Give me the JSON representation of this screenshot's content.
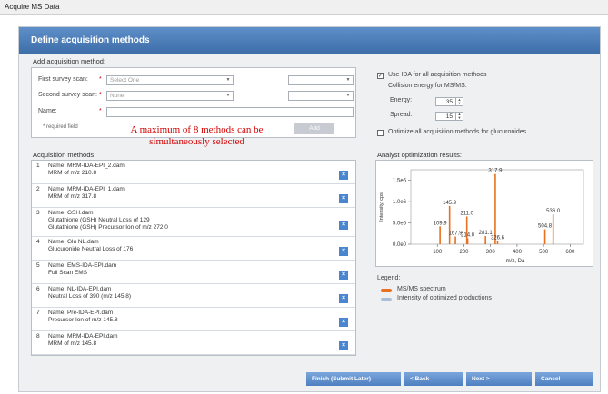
{
  "window": {
    "title": "Acquire MS Data"
  },
  "header": {
    "title": "Define acquisition methods"
  },
  "add_section": {
    "title": "Add acquisition method:",
    "first_survey_label": "First survey scan:",
    "first_survey_value": "Select One",
    "second_survey_label": "Second survey scan:",
    "second_survey_value": "None",
    "name_label": "Name:",
    "required_marker": "*",
    "required_note": "* required field",
    "add_button": "Add"
  },
  "note": "A maximum of 8 methods can be simultaneously selected",
  "methods_section": {
    "title": "Acquisition methods",
    "delete_glyph": "×",
    "items": [
      {
        "num": "1",
        "lines": [
          "Name: MRM-IDA-EPI_2.dam",
          "MRM of m/z 210.8"
        ]
      },
      {
        "num": "2",
        "lines": [
          "Name: MRM-IDA-EPI_1.dam",
          "MRM of m/z 317.8"
        ]
      },
      {
        "num": "3",
        "lines": [
          "Name: GSH.dam",
          "Glutathione (GSH) Neutral Loss of 129",
          "Glutathione (GSH) Precursor Ion of m/z 272.0"
        ]
      },
      {
        "num": "4",
        "lines": [
          "Name: Glu NL.dam",
          "Glucuronide Neutral Loss of 176"
        ]
      },
      {
        "num": "5",
        "lines": [
          "Name: EMS-IDA-EPI.dam",
          "Full Scan EMS"
        ]
      },
      {
        "num": "6",
        "lines": [
          "Name: NL-IDA-EPI.dam",
          "Neutral Loss of 390 (m/z 145.8)"
        ]
      },
      {
        "num": "7",
        "lines": [
          "Name: Pre-IDA-EPI.dam",
          "Precursor Ion of m/z 145.8"
        ]
      },
      {
        "num": "8",
        "lines": [
          "Name: MRM-IDA-EPI.dam",
          "MRM of m/z 145.8"
        ]
      }
    ]
  },
  "options": {
    "use_ida_label": "Use IDA for all acquisition methods",
    "use_ida_checked": true,
    "collision_label": "Collision energy for MS/MS:",
    "energy_label": "Energy:",
    "energy_value": "35",
    "spread_label": "Spread:",
    "spread_value": "15",
    "optimize_label": "Optimize all acquisition methods for glucuronides",
    "optimize_checked": false,
    "check_glyph": "✓"
  },
  "chart_title": "Analyst optimization results:",
  "chart_data": {
    "type": "bar",
    "title": "",
    "xlabel": "m/z, Da",
    "ylabel": "Intensity, cps",
    "xlim": [
      0,
      650
    ],
    "ylim": [
      0,
      1750000.0
    ],
    "x_ticks": [
      "100",
      "200",
      "300",
      "400",
      "500",
      "600"
    ],
    "y_ticks": [
      "0.0e0",
      "5.0e5",
      "1.0e6",
      "1.5e6"
    ],
    "series": [
      {
        "name": "MS/MS spectrum",
        "color": "#e8701e",
        "points": [
          {
            "x": 109.9,
            "y": 420000.0,
            "label": "109.9"
          },
          {
            "x": 145.9,
            "y": 900000.0,
            "label": "145.9"
          },
          {
            "x": 167.9,
            "y": 180000.0,
            "label": "167.9"
          },
          {
            "x": 211.0,
            "y": 650000.0,
            "label": "211.0"
          },
          {
            "x": 214.0,
            "y": 140000.0,
            "label": "214.0"
          },
          {
            "x": 281.1,
            "y": 190000.0,
            "label": "281.1"
          },
          {
            "x": 317.9,
            "y": 1650000.0,
            "label": "317.9"
          },
          {
            "x": 326.6,
            "y": 80000.0,
            "label": "326.6"
          },
          {
            "x": 504.8,
            "y": 350000.0,
            "label": "504.8"
          },
          {
            "x": 536.0,
            "y": 700000.0,
            "label": "536.0"
          }
        ]
      },
      {
        "name": "Intensity of optimized productions",
        "color": "#a9bfd9",
        "points": []
      }
    ],
    "legend_title": "Legend:"
  },
  "footer": {
    "finish_label": "Finish (Submit Later)",
    "back_label": "< Back",
    "next_label": "Next >",
    "cancel_label": "Cancel"
  }
}
